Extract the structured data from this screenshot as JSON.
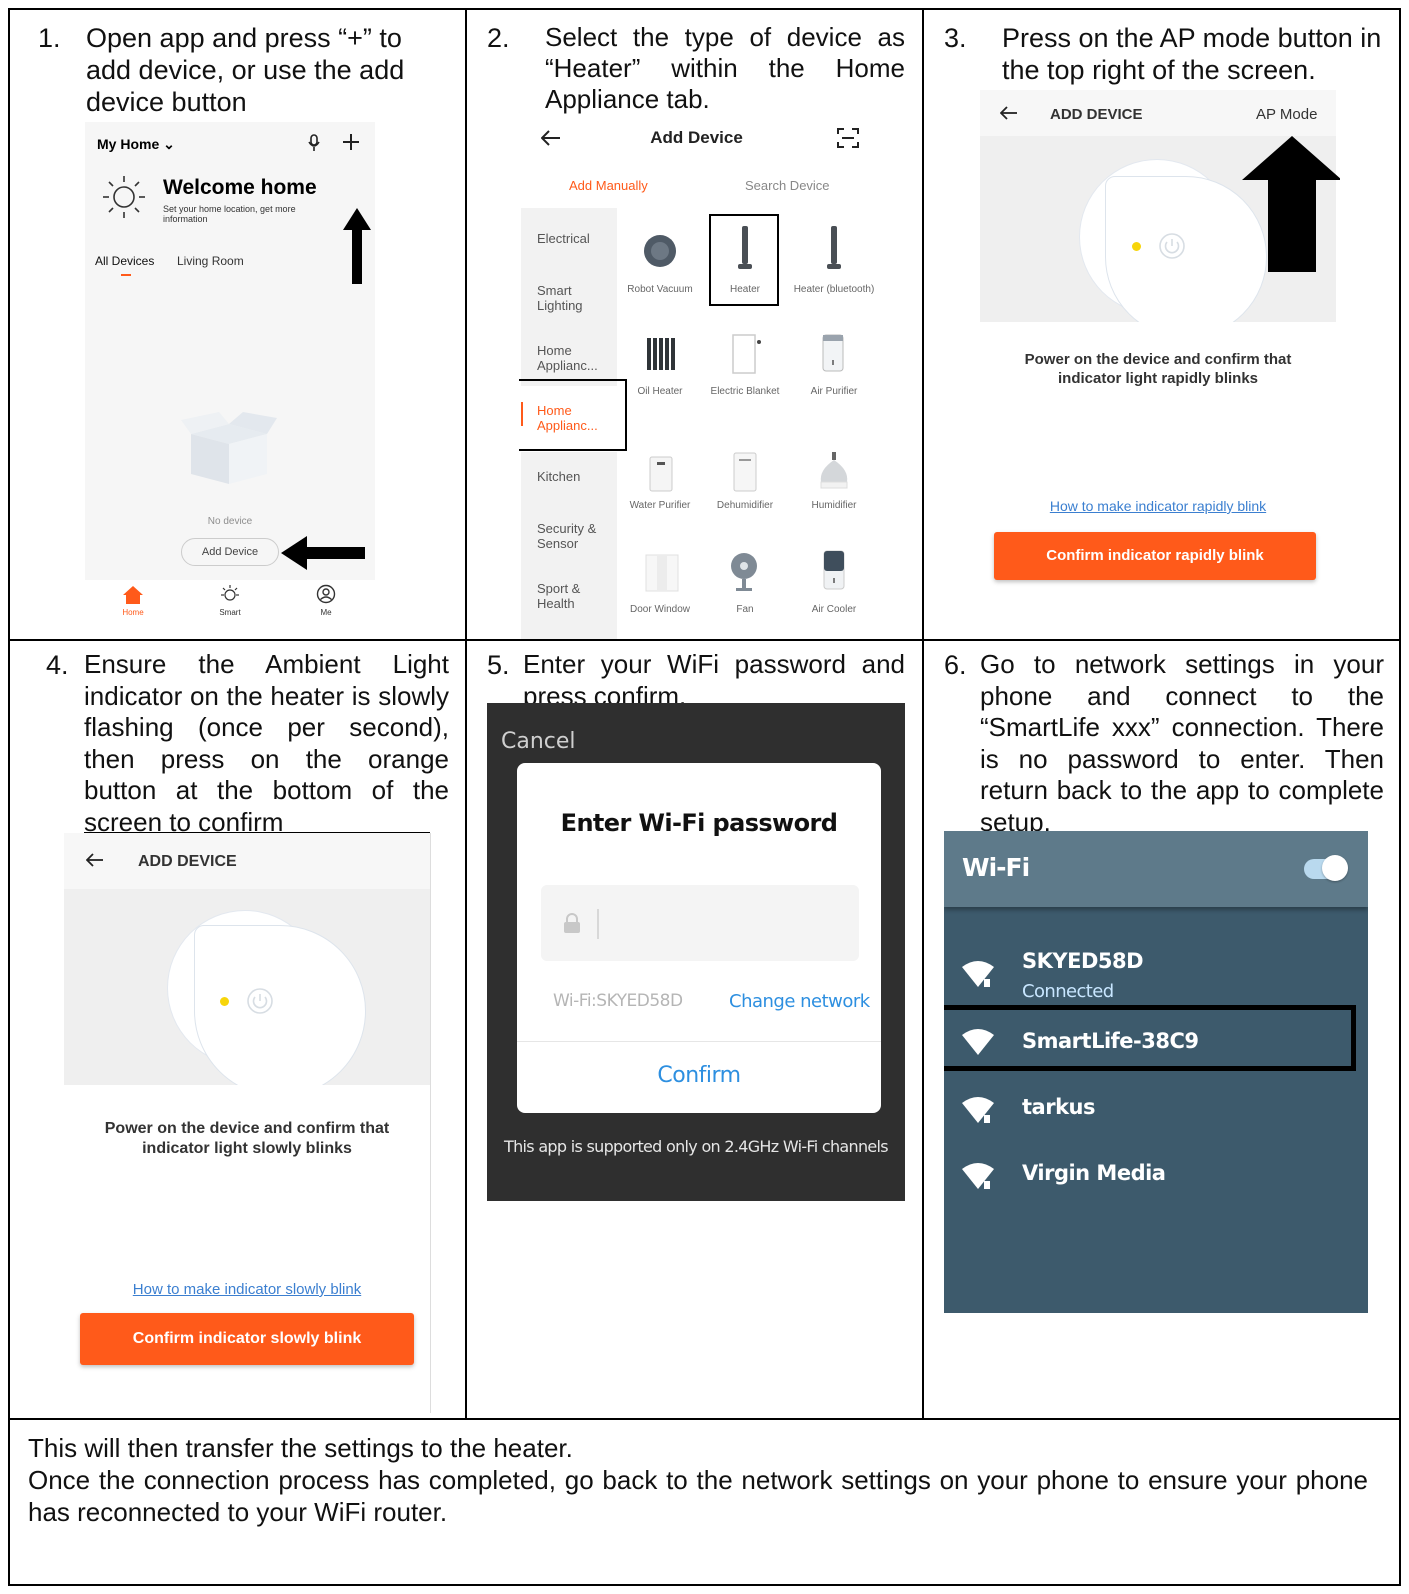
{
  "steps": {
    "s1": {
      "num": "1.",
      "text": "Open app and press “+” to add device, or use the add device button"
    },
    "s2": {
      "num": "2.",
      "text": "Select the type of device as “Heater” within the Home Appliance tab."
    },
    "s3": {
      "num": "3.",
      "text": "Press on the AP mode button in the top right of the screen."
    },
    "s4": {
      "num": "4.",
      "text": "Ensure the Ambient Light indicator on the heater is slowly flashing (once per second), then press on the orange button at the bottom of the screen to confirm"
    },
    "s5": {
      "num": "5.",
      "text": "Enter your WiFi password and press confirm."
    },
    "s6": {
      "num": "6.",
      "text": "Go to network settings in your phone and connect to the “SmartLife xxx” connection. There is no password to enter. Then return back to the app to complete setup."
    }
  },
  "screen1": {
    "home_title": "My Home ⌄",
    "welcome": "Welcome home",
    "welcome_sub": "Set your home location, get more information",
    "tab_all": "All Devices",
    "tab_living": "Living Room",
    "no_device": "No device",
    "add_device": "Add Device",
    "nav_home": "Home",
    "nav_smart": "Smart",
    "nav_me": "Me"
  },
  "screen2": {
    "title": "Add Device",
    "tab_manual": "Add Manually",
    "tab_search": "Search Device",
    "categories": [
      "Electrical",
      "Smart Lighting",
      "Home Applianc...",
      "Home Applianc...",
      "Kitchen",
      "Security & Sensor",
      "Sport & Health"
    ],
    "devices": [
      "Robot Vacuum",
      "Heater",
      "Heater (bluetooth)",
      "Oil Heater",
      "Electric Blanket",
      "Air Purifier",
      "Water Purifier",
      "Dehumidifier",
      "Humidifier",
      "Door Window",
      "Fan",
      "Air Cooler"
    ]
  },
  "screen3": {
    "title": "ADD DEVICE",
    "ap_mode": "AP Mode",
    "instruction": "Power on the device and confirm that indicator light rapidly blinks",
    "help_link": "How to make indicator rapidly blink",
    "confirm": "Confirm indicator rapidly blink"
  },
  "screen4": {
    "title": "ADD DEVICE",
    "instruction": "Power on the device and confirm that indicator light slowly blinks",
    "help_link": "How to make indicator slowly blink",
    "confirm": "Confirm indicator slowly blink"
  },
  "screen5": {
    "cancel": "Cancel",
    "dialog_title": "Enter Wi-Fi password",
    "wifi_label": "Wi-Fi:SKYED58D",
    "change_network": "Change network",
    "confirm": "Confirm",
    "note": "This app is supported only on 2.4GHz Wi-Fi channels"
  },
  "screen6": {
    "title": "Wi-Fi",
    "networks": [
      {
        "name": "SKYED58D",
        "status": "Connected"
      },
      {
        "name": "SmartLife-38C9",
        "status": ""
      },
      {
        "name": "tarkus",
        "status": ""
      },
      {
        "name": "Virgin Media",
        "status": ""
      }
    ]
  },
  "footer": {
    "line1": "This will then transfer the settings to the heater.",
    "line2": "Once the connection process has completed, go back to the network settings on your phone to ensure your phone has reconnected to your WiFi router."
  },
  "colors": {
    "accent_orange": "#ff5a1a",
    "link_blue": "#3b7fd0",
    "wifi_header": "#5e7a8a",
    "wifi_body": "#3d5a6c",
    "dialog_bg": "#2f2f2f"
  }
}
